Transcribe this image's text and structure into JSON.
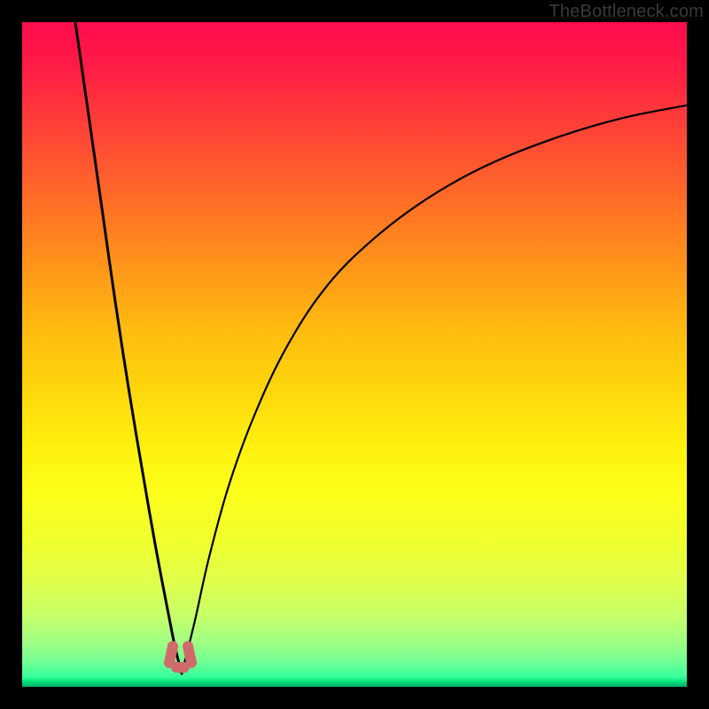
{
  "credit_text": "TheBottleneck.com",
  "colors": {
    "curve_stroke": "#000000",
    "marker_fill": "#cf6a6a",
    "frame_bg": "#000000"
  },
  "chart_data": {
    "type": "line",
    "title": "",
    "xlabel": "",
    "ylabel": "",
    "xlim": [
      0,
      100
    ],
    "ylim": [
      0,
      100
    ],
    "series": [
      {
        "name": "curve-left",
        "x": [
          8.0,
          10.0,
          12.0,
          14.0,
          16.0,
          18.0,
          20.0,
          22.0,
          23.0,
          24.0
        ],
        "y": [
          100.0,
          86.0,
          72.0,
          58.0,
          45.0,
          33.0,
          21.5,
          11.0,
          6.0,
          2.0
        ]
      },
      {
        "name": "curve-right",
        "x": [
          24.0,
          26.0,
          28.0,
          31.0,
          35.0,
          40.0,
          46.0,
          53.0,
          61.0,
          70.0,
          80.0,
          90.0,
          100.0
        ],
        "y": [
          2.0,
          10.0,
          19.0,
          30.0,
          41.0,
          51.5,
          60.5,
          67.5,
          73.5,
          78.5,
          82.5,
          85.5,
          87.5
        ]
      }
    ],
    "marker": {
      "x": 24.0,
      "y": 2.0,
      "shape": "u",
      "color": "#cf6a6a"
    }
  }
}
